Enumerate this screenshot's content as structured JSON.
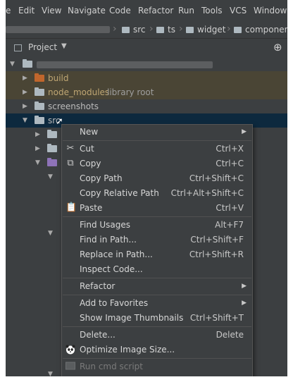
{
  "menubar": {
    "items": [
      "e",
      "Edit",
      "View",
      "Navigate",
      "Code",
      "Refactor",
      "Run",
      "Tools",
      "VCS",
      "Window"
    ]
  },
  "breadcrumb": {
    "items": [
      "src",
      "ts",
      "widget",
      "component"
    ]
  },
  "panel": {
    "title": "Project"
  },
  "tree": {
    "build": "build",
    "node_modules": "node_modules",
    "node_modules_suffix": "library root",
    "screenshots": "screenshots",
    "src": "src"
  },
  "context_menu": {
    "items": [
      {
        "label": "New",
        "shortcut": "",
        "submenu": true
      },
      {
        "label": "Cut",
        "shortcut": "Ctrl+X",
        "icon": "scissors-icon"
      },
      {
        "label": "Copy",
        "shortcut": "Ctrl+C",
        "icon": "copy-icon"
      },
      {
        "label": "Copy Path",
        "shortcut": "Ctrl+Shift+C"
      },
      {
        "label": "Copy Relative Path",
        "shortcut": "Ctrl+Alt+Shift+C"
      },
      {
        "label": "Paste",
        "shortcut": "Ctrl+V",
        "icon": "clipboard-icon"
      },
      {
        "label": "Find Usages",
        "shortcut": "Alt+F7"
      },
      {
        "label": "Find in Path...",
        "shortcut": "Ctrl+Shift+F"
      },
      {
        "label": "Replace in Path...",
        "shortcut": "Ctrl+Shift+R"
      },
      {
        "label": "Inspect Code...",
        "shortcut": ""
      },
      {
        "label": "Refactor",
        "shortcut": "",
        "submenu": true
      },
      {
        "label": "Add to Favorites",
        "shortcut": "",
        "submenu": true
      },
      {
        "label": "Show Image Thumbnails",
        "shortcut": "Ctrl+Shift+T"
      },
      {
        "label": "Delete...",
        "shortcut": "Delete"
      },
      {
        "label": "Optimize Image Size...",
        "shortcut": "",
        "icon": "panda-icon"
      },
      {
        "label": "Run cmd script",
        "shortcut": "",
        "disabled": true
      }
    ]
  },
  "colors": {
    "background": "#3c3f41",
    "selection": "#0d293e",
    "library_row": "#4a4535",
    "build_folder": "#c0662c",
    "source_folder": "#8e73b8"
  }
}
